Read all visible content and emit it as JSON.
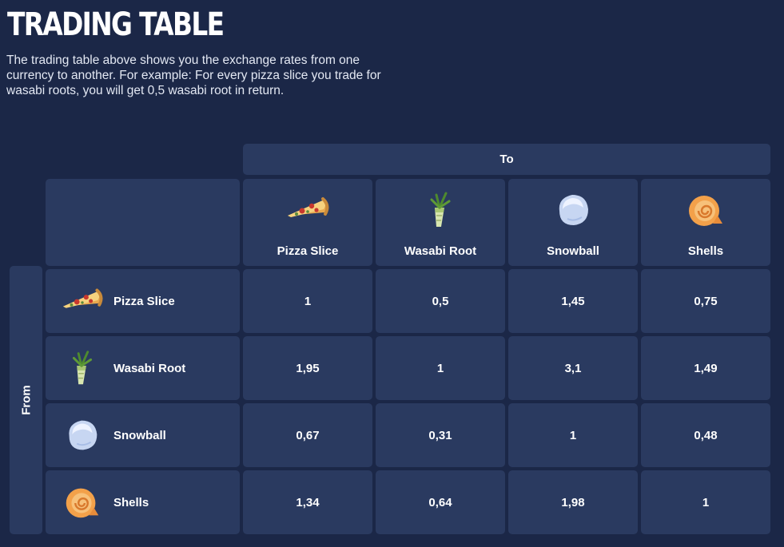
{
  "title": "TRADING TABLE",
  "description": "The trading table above shows you the exchange rates from one currency to another. For example: For every pizza slice you trade for wasabi roots, you will get 0,5 wasabi root in return.",
  "table": {
    "to_label": "To",
    "from_label": "From",
    "currencies": [
      {
        "label": "Pizza Slice",
        "icon": "pizza-slice-icon"
      },
      {
        "label": "Wasabi Root",
        "icon": "wasabi-root-icon"
      },
      {
        "label": "Snowball",
        "icon": "snowball-icon"
      },
      {
        "label": "Shells",
        "icon": "shell-icon"
      }
    ],
    "rows": [
      {
        "from": "Pizza Slice",
        "values": [
          "1",
          "0,5",
          "1,45",
          "0,75"
        ]
      },
      {
        "from": "Wasabi Root",
        "values": [
          "1,95",
          "1",
          "3,1",
          "1,49"
        ]
      },
      {
        "from": "Snowball",
        "values": [
          "0,67",
          "0,31",
          "1",
          "0,48"
        ]
      },
      {
        "from": "Shells",
        "values": [
          "1,34",
          "0,64",
          "1,98",
          "1"
        ]
      }
    ]
  },
  "colors": {
    "background": "#1b2747",
    "cell": "#2a3a60",
    "text": "#ffffff"
  }
}
